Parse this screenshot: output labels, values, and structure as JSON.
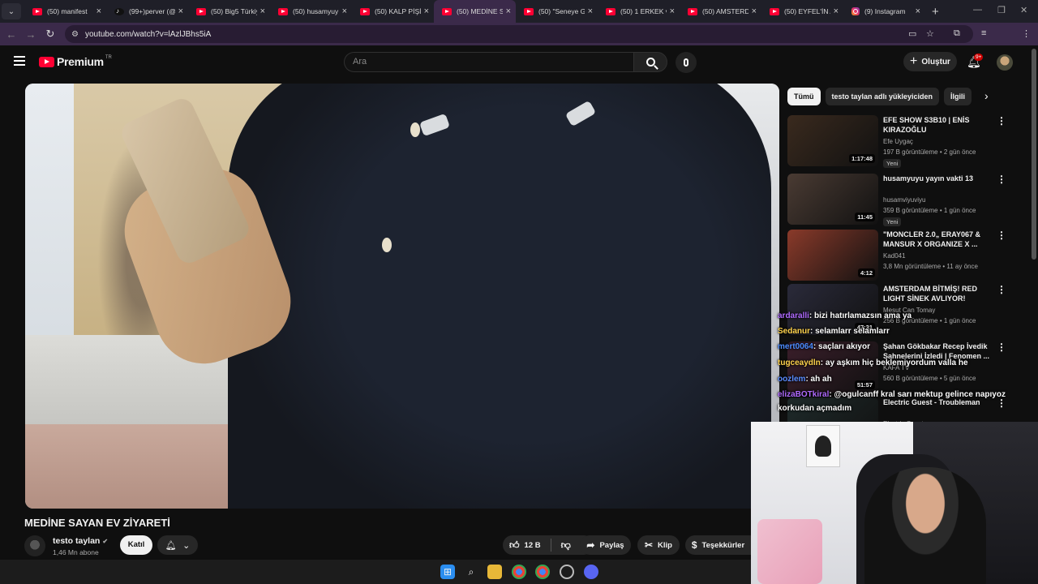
{
  "browser": {
    "tabs": [
      {
        "title": "(50) manifest",
        "icon": "youtube-icon"
      },
      {
        "title": "(99+)perver (@",
        "icon": "tiktok-icon"
      },
      {
        "title": "(50) Big5 Türkiy",
        "icon": "youtube-icon"
      },
      {
        "title": "(50) husamyuy",
        "icon": "youtube-icon"
      },
      {
        "title": "(50) KALP PİŞİ",
        "icon": "youtube-icon"
      },
      {
        "title": "(50) MEDİNE S",
        "icon": "youtube-icon",
        "active": true
      },
      {
        "title": "(50) \"Seneye G",
        "icon": "youtube-icon"
      },
      {
        "title": "(50) 1 ERKEK v",
        "icon": "youtube-icon"
      },
      {
        "title": "(50) AMSTERD",
        "icon": "youtube-icon"
      },
      {
        "title": "(50) EYFEL'İN A",
        "icon": "youtube-icon"
      },
      {
        "title": "(9) Instagram",
        "icon": "instagram-icon"
      }
    ],
    "url": "youtube.com/watch?v=lAzlJBhs5iA",
    "profile_initial": "P"
  },
  "youtube": {
    "logo_text": "Premium",
    "country": "TR",
    "search_placeholder": "Ara",
    "create_label": "Oluştur",
    "notif_badge": "9+"
  },
  "video": {
    "title": "MEDİNE SAYAN EV ZİYARETİ",
    "channel": "testo taylan",
    "subscribers": "1,46 Mn abone",
    "join_label": "Katıl",
    "likes": "12 B",
    "share_label": "Paylaş",
    "clip_label": "Klip",
    "thanks_label": "Teşekkürler"
  },
  "chips": [
    "Tümü",
    "testo taylan adlı yükleyiciden",
    "İlgili"
  ],
  "recommendations": [
    {
      "title": "EFE SHOW S3B10 | ENİS KIRAZOĞLU",
      "channel": "Efe Uygaç",
      "meta": "197 B görüntüleme • 2 gün önce",
      "duration": "1:17:48",
      "badge": "Yeni",
      "color": "#3a2a1e"
    },
    {
      "title": "husamyuyu yayın vakti 13",
      "channel": "husamviyuviyu",
      "meta": "359 B görüntüleme • 1 gün önce",
      "duration": "11:45",
      "badge": "Yeni",
      "color": "#4a3b33"
    },
    {
      "title": "\"MONCLER 2.0„ ERAY067 & MANSUR X ORGANIZE X ...",
      "channel": "Kad041",
      "meta": "3,8 Mn görüntüleme • 11 ay önce",
      "duration": "4:12",
      "badge": "",
      "color": "#8a3a2a"
    },
    {
      "title": "AMSTERDAM BİTMİŞ! RED LIGHT SİNEK AVLIYOR!",
      "channel": "Mesut Can Tomay",
      "meta": "256 B görüntüleme • 1 gün önce",
      "duration": "47:31",
      "badge": "",
      "color": "#2a2a3a"
    },
    {
      "title": "Şahan Gökbakar Recep İvedik Sahnelerini İzledi | Fenomen ...",
      "channel": "KAFA TV",
      "meta": "560 B görüntüleme • 5 gün önce",
      "duration": "51:57",
      "badge": "",
      "color": "#3a1e2a"
    },
    {
      "title": "Electric Guest - Troubleman",
      "channel": "Electric Guest",
      "meta": "",
      "duration": "",
      "badge": "",
      "color": "#1e2a2a"
    }
  ],
  "chat": [
    {
      "user": "ardaralli",
      "text": ": bizi hatırlamazsın ama ya",
      "color": "#b06bff"
    },
    {
      "user": "Sedanur",
      "text": ": selamlarr selamlarr",
      "color": "#ffd34d"
    },
    {
      "user": "mert0064",
      "text": ": saçları akıyor",
      "color": "#4d8cff"
    },
    {
      "user": "tugceaydln",
      "text": ": ay aşkım hiç beklemiyordum valla he",
      "color": "#ffd34d"
    },
    {
      "user": "oozlem",
      "text": ": ah ah",
      "color": "#5b8dff"
    },
    {
      "user": "elizaBOTkiral",
      "text": ": @ogulcanff kral sarı mektup gelince napıyoz",
      "color": "#b06bff"
    },
    {
      "user": "",
      "text": "korkudan açmadım",
      "color": "#ffffff"
    }
  ]
}
